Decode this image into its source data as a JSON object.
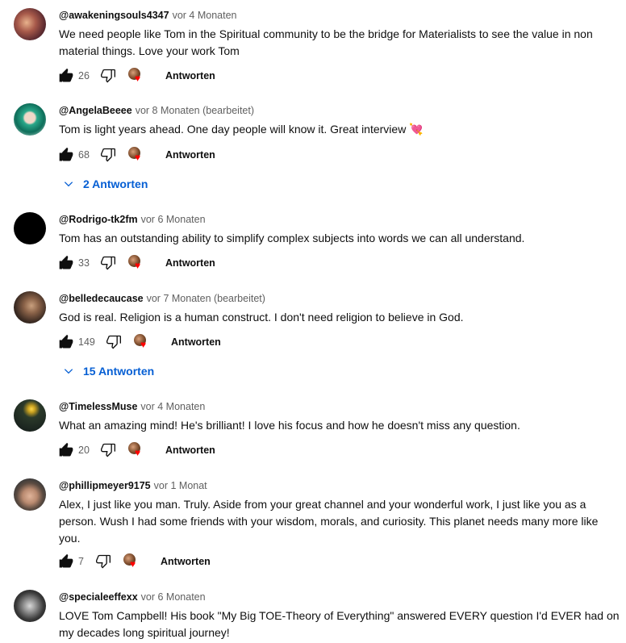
{
  "comments": [
    {
      "author": "@awakeningsouls4347",
      "time": "vor 4 Monaten",
      "text": "We need people like Tom in the Spiritual community to be the bridge for Materialists to see the value in non material things. Love your work Tom",
      "likes": "26",
      "reply_label": "Antworten"
    },
    {
      "author": "@AngelaBeeee",
      "time": "vor 8 Monaten (bearbeitet)",
      "text": "Tom is light years ahead.  One day people will know it.  Great interview 💘",
      "likes": "68",
      "reply_label": "Antworten",
      "replies": "2 Antworten"
    },
    {
      "author": "@Rodrigo-tk2fm",
      "time": "vor 6 Monaten",
      "text": "Tom has an outstanding ability to simplify complex subjects into words we can all understand.",
      "likes": "33",
      "reply_label": "Antworten"
    },
    {
      "author": "@belledecaucase",
      "time": "vor 7 Monaten (bearbeitet)",
      "text": "God is real. Religion is a human construct. I don't need religion to believe in God.",
      "likes": "149",
      "reply_label": "Antworten",
      "replies": "15 Antworten"
    },
    {
      "author": "@TimelessMuse",
      "time": "vor 4 Monaten",
      "text": "What an amazing mind! He's brilliant! I love his focus and how he doesn't miss any question.",
      "likes": "20",
      "reply_label": "Antworten"
    },
    {
      "author": "@phillipmeyer9175",
      "time": "vor 1 Monat",
      "text": "Alex, I just like you man. Truly. Aside from your great channel and your wonderful work, I just like you as a person. Wush I had some friends with your wisdom, morals, and curiosity. This planet needs many more like you.",
      "likes": "7",
      "reply_label": "Antworten"
    },
    {
      "author": "@specialeeffexx",
      "time": "vor 6 Monaten",
      "text": "LOVE Tom Campbell! His book \"My Big TOE-Theory of Everything\" answered EVERY question I'd EVER had on my decades long spiritual journey!"
    }
  ],
  "colors": {
    "link_blue": "#065fd4",
    "heart_red": "#ff0000",
    "meta_gray": "#606060"
  },
  "icons": [
    "like-icon",
    "dislike-icon",
    "creator-heart-icon",
    "chevron-down-icon"
  ]
}
